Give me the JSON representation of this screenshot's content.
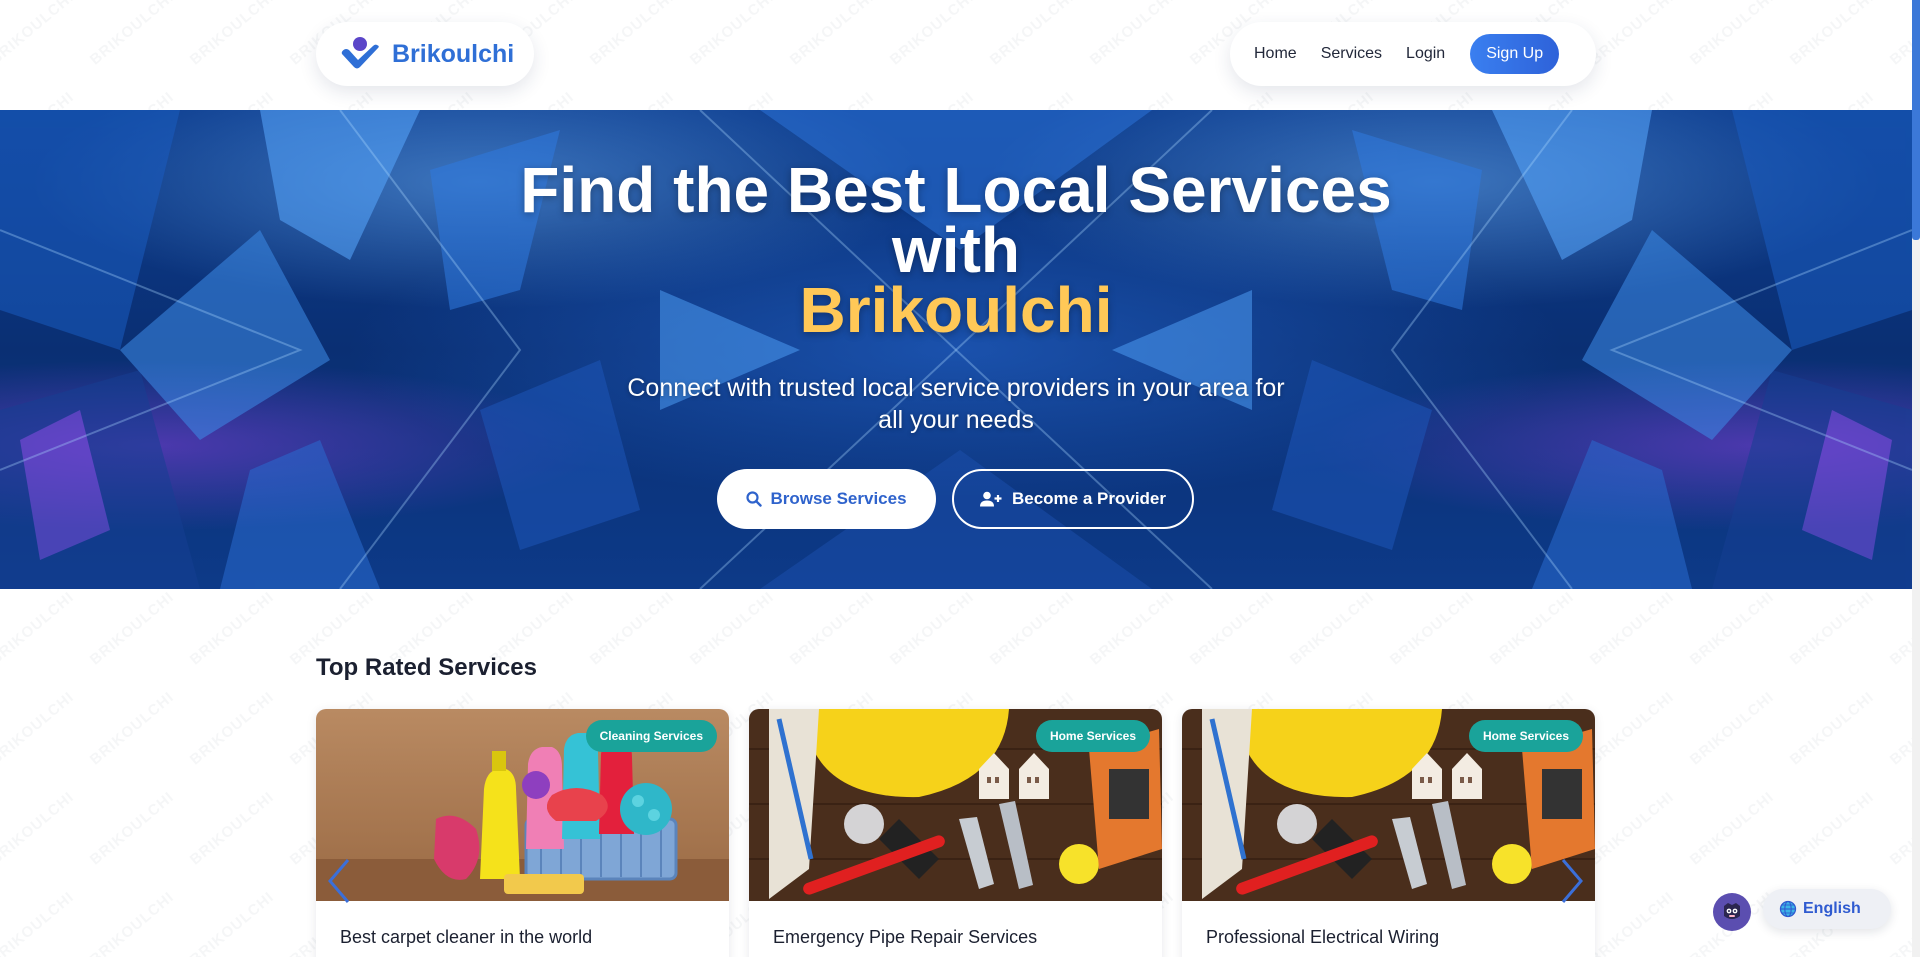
{
  "header": {
    "brand": "Brikoulchi",
    "nav": {
      "home": "Home",
      "services": "Services",
      "login": "Login",
      "signup": "Sign Up"
    }
  },
  "hero": {
    "title_line1": "Find the Best Local Services",
    "title_line2": "with",
    "title_accent": "Brikoulchi",
    "subtitle": "Connect with trusted local service providers in your area for all your needs",
    "browse_label": "Browse Services",
    "provider_label": "Become a Provider"
  },
  "top_rated": {
    "title": "Top Rated Services",
    "cards": [
      {
        "title": "Best carpet cleaner in the world",
        "category": "Cleaning Services"
      },
      {
        "title": "Emergency Pipe Repair Services",
        "category": "Home Services"
      },
      {
        "title": "Professional Electrical Wiring",
        "category": "Home Services"
      }
    ]
  },
  "language": {
    "label": "English"
  },
  "watermark_text": "BRIKOULCHI",
  "colors": {
    "brand_blue": "#2f6fd6",
    "accent_yellow": "#ffc857",
    "badge_teal": "#1aa39a",
    "hero_blue": "#0d3d8f"
  },
  "icons": [
    "brand-logo-icon",
    "search-icon",
    "user-plus-icon",
    "chevron-left-icon",
    "chevron-right-icon",
    "mascot-icon",
    "globe-icon"
  ]
}
